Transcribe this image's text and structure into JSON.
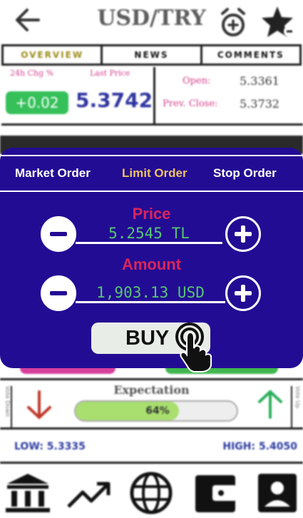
{
  "header": {
    "title": "USD/TRY",
    "back_icon": "arrow-left-icon",
    "alarm_icon": "alarm-clock-plus-icon",
    "favorite_icon": "star-icon"
  },
  "tabs": [
    "OVERVIEW",
    "NEWS",
    "COMMENTS"
  ],
  "quote": {
    "chg_label": "24h Chg %",
    "last_label": "Last Price",
    "chg_value": "+0.02",
    "last_price": "5.3742",
    "open_label": "Open:",
    "open_value": "5.3361",
    "prev_close_label": "Prev. Close:",
    "prev_close_value": "5.3732"
  },
  "order": {
    "tabs": [
      "Market Order",
      "Limit Order",
      "Stop Order"
    ],
    "active_tab": "Limit Order",
    "price_label": "Price",
    "price_value": "5.2545 TL",
    "amount_label": "Amount",
    "amount_value": "1,903.13 USD",
    "buy_label": "BUY"
  },
  "expectation": {
    "title": "Expectation",
    "percent": "64%",
    "fill_fraction": 0.64,
    "vote_down_label": "Vote Down",
    "vote_up_label": "Vote Up"
  },
  "range": {
    "low": "LOW: 5.3335",
    "high": "HIGH: 5.4050"
  },
  "bottom_nav": [
    "bank-icon",
    "trending-up-icon",
    "globe-icon",
    "wallet-icon",
    "account-icon"
  ],
  "colors": {
    "panel": "#230c94",
    "active_tab": "#f0c25e",
    "field_label": "#d8265a",
    "field_value": "#56c772",
    "positive": "#35c05a"
  }
}
